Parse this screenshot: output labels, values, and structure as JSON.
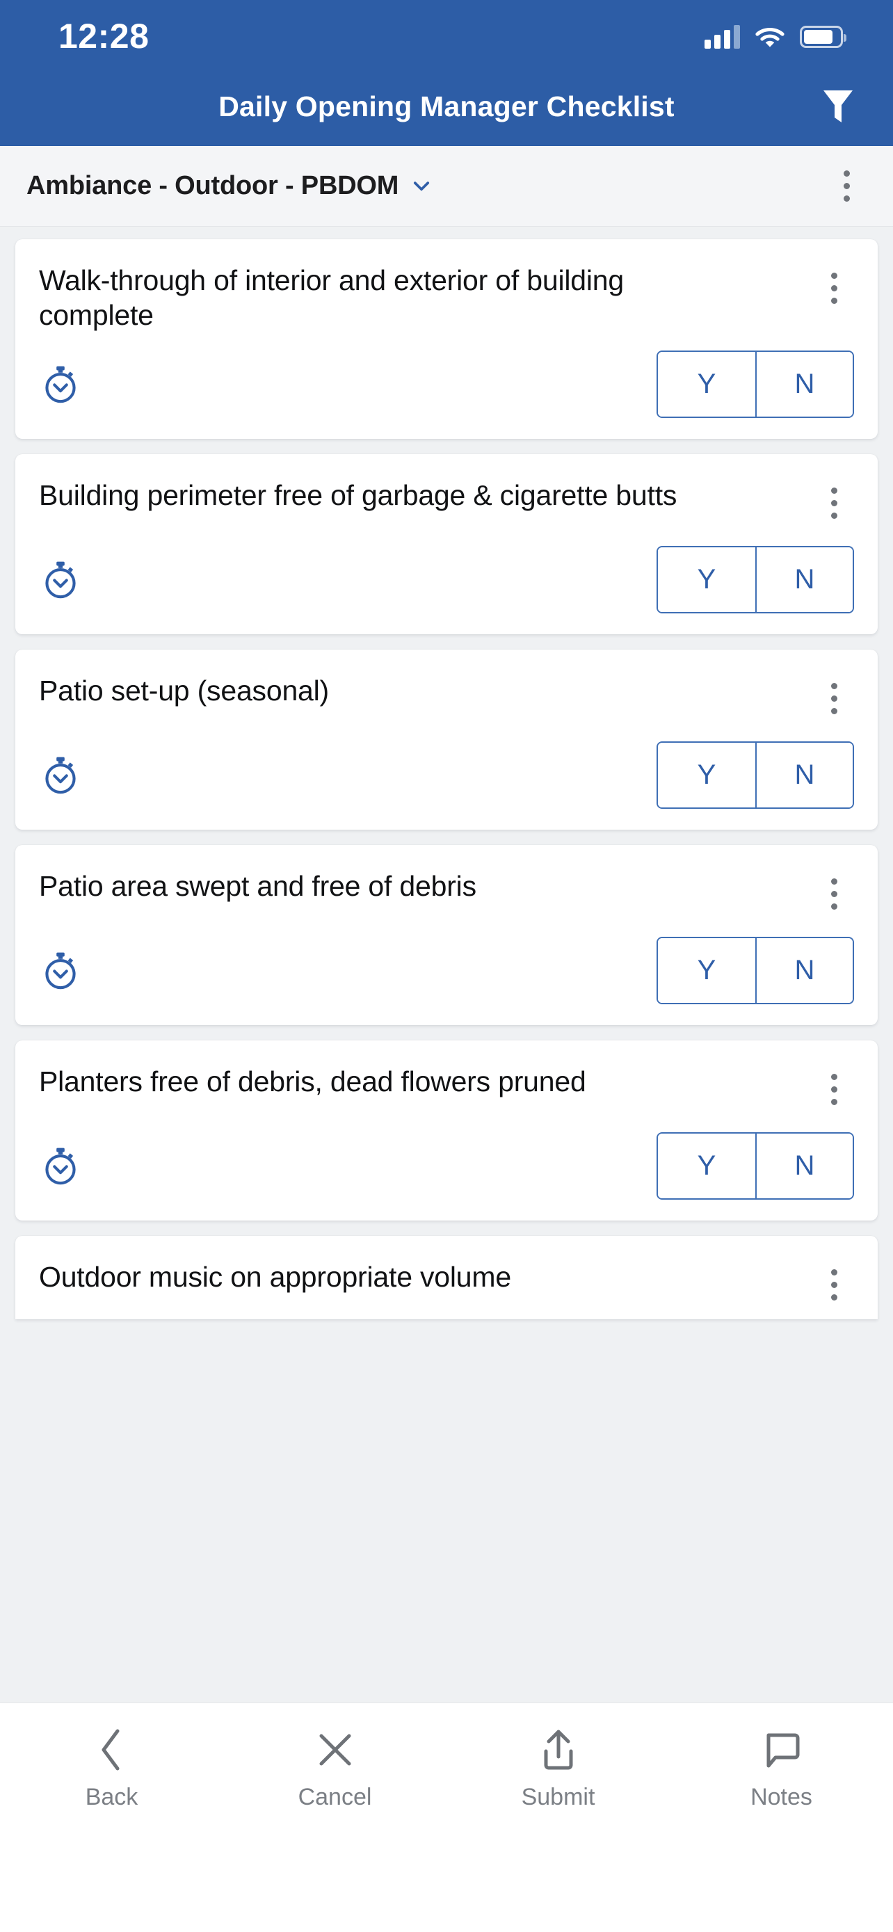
{
  "status_bar": {
    "time": "12:28",
    "signal_icon": "cellular-signal-icon",
    "wifi_icon": "wifi-icon",
    "battery_icon": "battery-icon"
  },
  "app_bar": {
    "title": "Daily Opening Manager Checklist",
    "filter_icon": "filter-funnel-icon",
    "background_color": "#2d5da6"
  },
  "section": {
    "title": "Ambiance - Outdoor - PBDOM",
    "chevron_icon": "chevron-down-icon",
    "menu_icon": "kebab-menu-icon"
  },
  "answer_options": {
    "yes": "Y",
    "no": "N",
    "accent_color": "#2f5ea8"
  },
  "items": [
    {
      "text": "Walk-through of interior and exterior of building complete",
      "timer_icon": "stopwatch-icon",
      "menu_icon": "kebab-menu-icon",
      "answer": "",
      "clipped": false
    },
    {
      "text": "Building perimeter free of garbage & cigarette butts",
      "timer_icon": "stopwatch-icon",
      "menu_icon": "kebab-menu-icon",
      "answer": "",
      "clipped": false
    },
    {
      "text": "Patio set-up (seasonal)",
      "timer_icon": "stopwatch-icon",
      "menu_icon": "kebab-menu-icon",
      "answer": "",
      "clipped": false
    },
    {
      "text": "Patio area swept and free of debris",
      "timer_icon": "stopwatch-icon",
      "menu_icon": "kebab-menu-icon",
      "answer": "",
      "clipped": false
    },
    {
      "text": "Planters free of debris, dead flowers pruned",
      "timer_icon": "stopwatch-icon",
      "menu_icon": "kebab-menu-icon",
      "answer": "",
      "clipped": false
    },
    {
      "text": "Outdoor music on appropriate volume",
      "timer_icon": "stopwatch-icon",
      "menu_icon": "kebab-menu-icon",
      "answer": "",
      "clipped": true
    }
  ],
  "bottom_nav": [
    {
      "label": "Back",
      "icon": "chevron-left-icon"
    },
    {
      "label": "Cancel",
      "icon": "close-x-icon"
    },
    {
      "label": "Submit",
      "icon": "upload-share-icon"
    },
    {
      "label": "Notes",
      "icon": "speech-bubble-icon"
    }
  ]
}
